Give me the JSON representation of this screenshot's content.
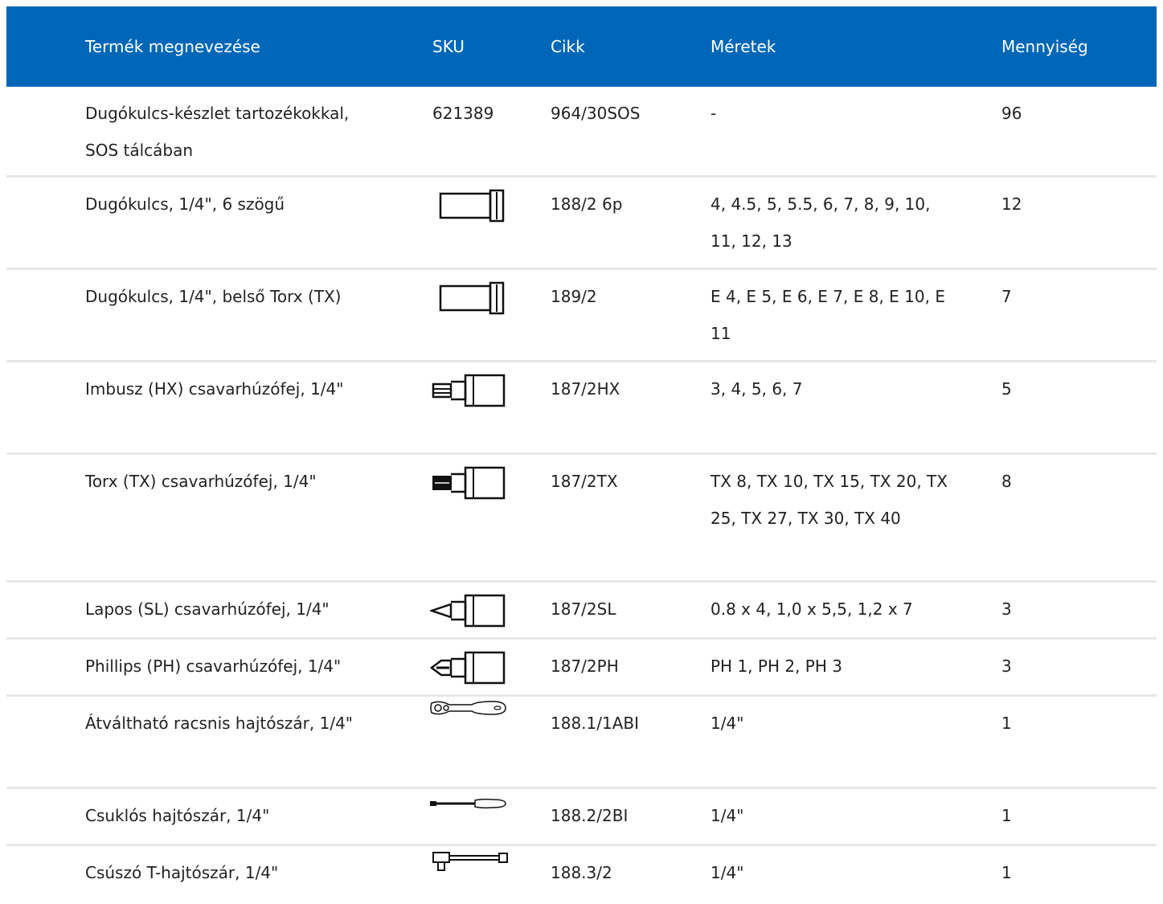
{
  "header": {
    "name": "Termék megnevezése",
    "sku": "SKU",
    "cikk": "Cikk",
    "meretek": "Méretek",
    "qty": "Mennyiség"
  },
  "rows": [
    {
      "name": "Dugókulcs-készlet tartozékokkal, SOS tálcában",
      "sku": "621389",
      "icon": null,
      "cikk": "964/30SOS",
      "meretek": "-",
      "qty": "96"
    },
    {
      "name": "Dugókulcs, 1/4\", 6 szögű",
      "sku": "",
      "icon": "socket-icon",
      "cikk": "188/2 6p",
      "meretek": "4, 4.5, 5, 5.5, 6, 7, 8, 9, 10, 11, 12, 13",
      "qty": "12"
    },
    {
      "name": "Dugókulcs, 1/4\", belső Torx (TX)",
      "sku": "",
      "icon": "socket-icon",
      "cikk": "189/2",
      "meretek": "E 4, E 5, E 6, E 7, E 8, E 10, E 11",
      "qty": "7"
    },
    {
      "name": "Imbusz (HX) csavarhúzófej, 1/4\"",
      "sku": "",
      "icon": "hex-bit-socket-icon",
      "cikk": "187/2HX",
      "meretek": "3, 4, 5, 6, 7",
      "qty": "5"
    },
    {
      "name": "Torx (TX) csavarhúzófej, 1/4\"",
      "sku": "",
      "icon": "torx-bit-socket-icon",
      "cikk": "187/2TX",
      "meretek": "TX 8, TX 10, TX 15, TX 20, TX 25, TX 27, TX 30, TX 40",
      "qty": "8"
    },
    {
      "name": "Lapos (SL) csavarhúzófej, 1/4\"",
      "sku": "",
      "icon": "slotted-bit-socket-icon",
      "cikk": "187/2SL",
      "meretek": "0.8 x 4, 1,0 x 5,5, 1,2 x 7",
      "qty": "3"
    },
    {
      "name": "Phillips (PH) csavarhúzófej, 1/4\"",
      "sku": "",
      "icon": "phillips-bit-socket-icon",
      "cikk": "187/2PH",
      "meretek": "PH 1, PH 2, PH 3",
      "qty": "3"
    },
    {
      "name": "Átváltható racsnis hajtószár, 1/4\"",
      "sku": "",
      "icon": "ratchet-icon",
      "cikk": "188.1/1ABI",
      "meretek": "1/4\"",
      "qty": "1"
    },
    {
      "name": "Csuklós hajtószár, 1/4\"",
      "sku": "",
      "icon": "hinged-handle-icon",
      "cikk": "188.2/2BI",
      "meretek": "1/4\"",
      "qty": "1"
    },
    {
      "name": "Csúszó T-hajtószár, 1/4\"",
      "sku": "",
      "icon": "sliding-t-handle-icon",
      "cikk": "188.3/2",
      "meretek": "1/4\"",
      "qty": "1"
    }
  ]
}
